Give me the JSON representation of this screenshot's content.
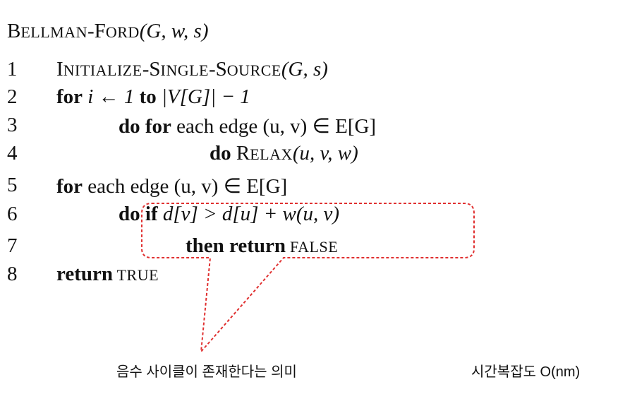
{
  "title": {
    "name_first": "B",
    "name_rest": "ELLMAN",
    "dash": "-",
    "name2_first": "F",
    "name2_rest": "ORD",
    "args": "(G, w, s)"
  },
  "lines": [
    {
      "num": "1",
      "parts": [
        "I",
        "NITIALIZE",
        "-",
        "S",
        "INGLE",
        "-",
        "S",
        "OURCE",
        "(G, s)"
      ]
    },
    {
      "num": "2",
      "kw": "for",
      "text": " i ← 1 ",
      "kw2": "to",
      "text2": " |V[G]| − 1"
    },
    {
      "num": "3",
      "kw": "do for",
      "text": " each edge (u, v) ∈ E[G]"
    },
    {
      "num": "4",
      "kw": "do",
      "text_first": " R",
      "text_rest": "ELAX",
      "args": "(u, v, w)"
    },
    {
      "num": "5",
      "kw": "for",
      "text": " each edge (u, v) ∈ E[G]"
    },
    {
      "num": "6",
      "kw": "do",
      "kw2": " if",
      "text": " d[v] > d[u] + w(u, v)"
    },
    {
      "num": "7",
      "kw": "then return",
      "text": " FALSE"
    },
    {
      "num": "8",
      "kw": "return",
      "text": " TRUE"
    }
  ],
  "annotations": {
    "negative_cycle": "음수 사이클이 존재한다는 의미",
    "complexity": "시간복잡도 O(nm)"
  },
  "colors": {
    "callout": "#e03030",
    "text": "#111111"
  }
}
